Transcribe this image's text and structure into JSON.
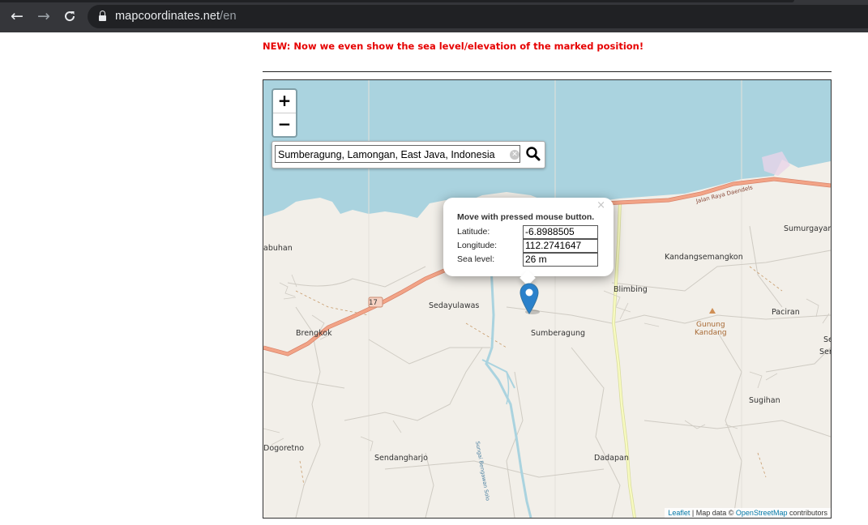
{
  "browser": {
    "url_domain": "mapcoordinates.net",
    "url_path": "/en",
    "icons": {
      "back": "arrow-left-icon",
      "forward": "arrow-right-icon",
      "reload": "reload-icon",
      "secure": "lock-icon"
    }
  },
  "page": {
    "notice": "NEW: Now we even show the sea level/elevation of the marked position!"
  },
  "map": {
    "zoom_in": "+",
    "zoom_out": "−",
    "search": {
      "value": "Sumberagung, Lamongan, East Java, Indonesia"
    },
    "popup": {
      "close": "×",
      "hint": "Move with pressed mouse button.",
      "latitude_label": "Latitude:",
      "latitude_value": "-6.8988505",
      "longitude_label": "Longitude:",
      "longitude_value": "112.2741647",
      "sea_level_label": "Sea level:",
      "sea_level_value": "26 m"
    },
    "labels": {
      "road_17": "17",
      "jalan": "Jalan Raya Daendels",
      "labuhan": "abuhan",
      "brengkok": "Brengkok",
      "sedayulawas": "Sedayulawas",
      "sumberagung": "Sumberagung",
      "blimbing": "Blimbing",
      "kandangsemangkon": "Kandangsemangkon",
      "sumurgayam": "Sumurgayan",
      "paciran": "Paciran",
      "gunung": "Gunung",
      "kandang": "Kandang",
      "se": "Se",
      "ser": "Ser",
      "sugihan": "Sugihan",
      "dogoretno": "Dogoretno",
      "sendangharjo": "Sendangharjo",
      "dadapan": "Dadapan",
      "sungai": "Sungai Bengawan Solo"
    },
    "attribution": {
      "leaflet": "Leaflet",
      "sep": " | Map data © ",
      "osm": "OpenStreetMap",
      "contributors": " contributors"
    },
    "colors": {
      "sea": "#aad3df",
      "land": "#f2efe9",
      "primary_road": "#f2a487",
      "secondary_road": "#f7fabf",
      "river": "#aad3df",
      "marker": "#2a81cb"
    }
  }
}
